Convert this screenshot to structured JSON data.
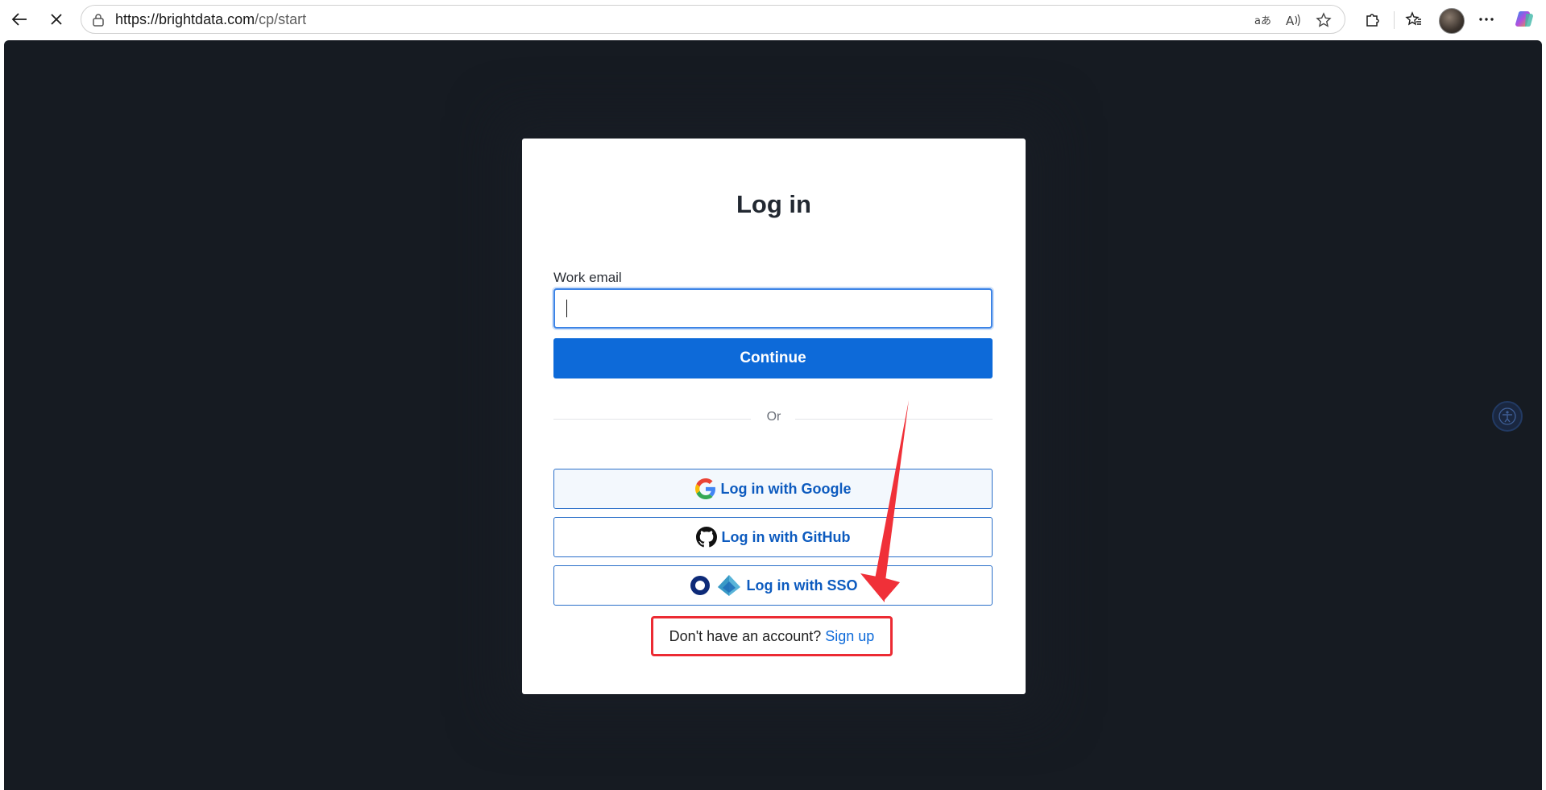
{
  "browser": {
    "url_host": "https://brightdata.com",
    "url_path": "/cp/start",
    "icons": {
      "back": "back-arrow-icon",
      "stop": "close-icon",
      "lock": "lock-icon",
      "translate": "translate-icon",
      "read_aloud": "read-aloud-icon",
      "favorite": "star-icon",
      "extensions": "puzzle-icon",
      "favorites_bar": "favorites-icon",
      "more": "more-icon",
      "copilot": "copilot-icon"
    }
  },
  "login": {
    "title": "Log in",
    "email_label": "Work email",
    "email_value": "",
    "continue_label": "Continue",
    "divider_text": "Or",
    "google_label": "Log in with Google",
    "github_label": "Log in with GitHub",
    "sso_label": "Log in with SSO",
    "signup_prompt": "Don't have an account?",
    "signup_link": "Sign up"
  },
  "annotation": {
    "highlight_color": "#ec2b33",
    "arrow_color": "#f03038"
  }
}
